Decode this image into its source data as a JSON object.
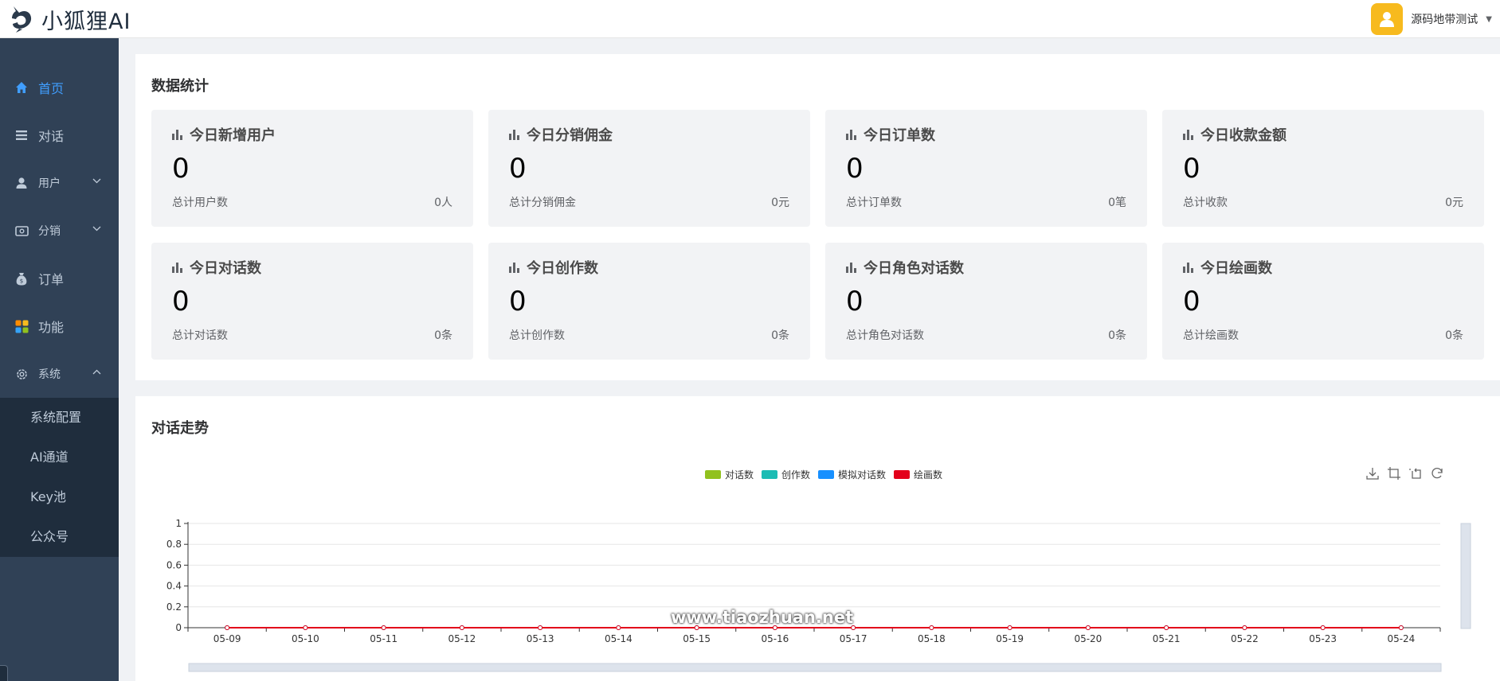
{
  "app": {
    "logo_text": "小狐狸AI"
  },
  "user": {
    "name": "源码地带测试"
  },
  "sidebar": {
    "items": [
      {
        "label": "首页",
        "icon": "home-icon"
      },
      {
        "label": "对话",
        "icon": "list-icon"
      },
      {
        "label": "用户",
        "icon": "user-icon"
      },
      {
        "label": "分销",
        "icon": "wallet-icon"
      },
      {
        "label": "订单",
        "icon": "money-bag-icon"
      },
      {
        "label": "功能",
        "icon": "apps-icon"
      },
      {
        "label": "系统",
        "icon": "gear-icon"
      }
    ],
    "system_sub": [
      "系统配置",
      "AI通道",
      "Key池",
      "公众号"
    ]
  },
  "stats": {
    "title": "数据统计",
    "cards": [
      {
        "title": "今日新增用户",
        "value": "0",
        "sub_label": "总计用户数",
        "total": "0人"
      },
      {
        "title": "今日分销佣金",
        "value": "0",
        "sub_label": "总计分销佣金",
        "total": "0元"
      },
      {
        "title": "今日订单数",
        "value": "0",
        "sub_label": "总计订单数",
        "total": "0笔"
      },
      {
        "title": "今日收款金额",
        "value": "0",
        "sub_label": "总计收款",
        "total": "0元"
      },
      {
        "title": "今日对话数",
        "value": "0",
        "sub_label": "总计对话数",
        "total": "0条"
      },
      {
        "title": "今日创作数",
        "value": "0",
        "sub_label": "总计创作数",
        "total": "0条"
      },
      {
        "title": "今日角色对话数",
        "value": "0",
        "sub_label": "总计角色对话数",
        "total": "0条"
      },
      {
        "title": "今日绘画数",
        "value": "0",
        "sub_label": "总计绘画数",
        "total": "0条"
      }
    ]
  },
  "chart_panel": {
    "title": "对话走势",
    "watermark": "www.tiaozhuan.net"
  },
  "colors": {
    "accent": "#409eff",
    "sidebar_bg": "#304156",
    "submenu_bg": "#1f2d3d",
    "avatar_bg": "#f7ba1e"
  },
  "chart_data": {
    "type": "line",
    "categories": [
      "05-09",
      "05-10",
      "05-11",
      "05-12",
      "05-13",
      "05-14",
      "05-15",
      "05-16",
      "05-17",
      "05-18",
      "05-19",
      "05-20",
      "05-21",
      "05-22",
      "05-23",
      "05-24"
    ],
    "series": [
      {
        "name": "对话数",
        "color": "#91c11e",
        "values": [
          0,
          0,
          0,
          0,
          0,
          0,
          0,
          0,
          0,
          0,
          0,
          0,
          0,
          0,
          0,
          0
        ]
      },
      {
        "name": "创作数",
        "color": "#1cbcb4",
        "values": [
          0,
          0,
          0,
          0,
          0,
          0,
          0,
          0,
          0,
          0,
          0,
          0,
          0,
          0,
          0,
          0
        ]
      },
      {
        "name": "模拟对话数",
        "color": "#1890ff",
        "values": [
          0,
          0,
          0,
          0,
          0,
          0,
          0,
          0,
          0,
          0,
          0,
          0,
          0,
          0,
          0,
          0
        ]
      },
      {
        "name": "绘画数",
        "color": "#e3001b",
        "values": [
          0,
          0,
          0,
          0,
          0,
          0,
          0,
          0,
          0,
          0,
          0,
          0,
          0,
          0,
          0,
          0
        ]
      }
    ],
    "yticks": [
      "0",
      "0.2",
      "0.4",
      "0.6",
      "0.8",
      "1"
    ],
    "ylim": [
      0,
      1
    ],
    "grid": true,
    "legend_position": "top-center",
    "data_zoom": true
  }
}
